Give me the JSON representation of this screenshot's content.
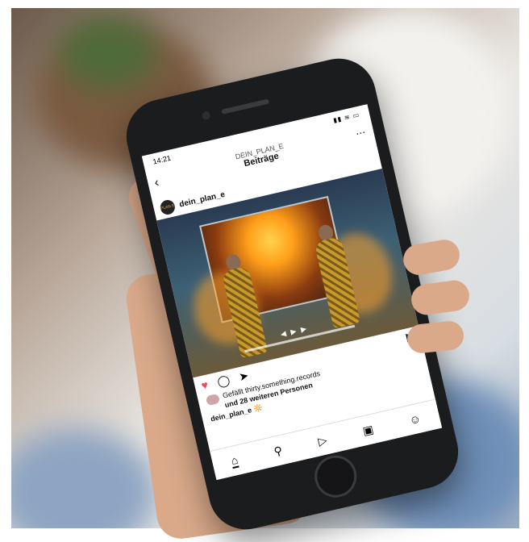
{
  "status": {
    "time": "14:21",
    "icons": "▮▮ ≋ ▭"
  },
  "nav": {
    "username": "DEIN_PLAN_E",
    "title": "Beiträge",
    "back_icon": "chevron-left-icon",
    "more_icon": "more-icon"
  },
  "post": {
    "user": "dein_plan_e",
    "avatar_text": "PLAN E",
    "likes_line1": "Gefällt thirty.something.records",
    "likes_line2": "und 28 weiteren Personen",
    "caption": "dein_plan_e 🔆"
  },
  "tabbar": {
    "icons": [
      "home-icon",
      "search-icon",
      "reels-icon",
      "shop-icon",
      "profile-icon"
    ]
  },
  "colors": {
    "heart": "#ed4956",
    "phone": "#1b1c1e"
  }
}
